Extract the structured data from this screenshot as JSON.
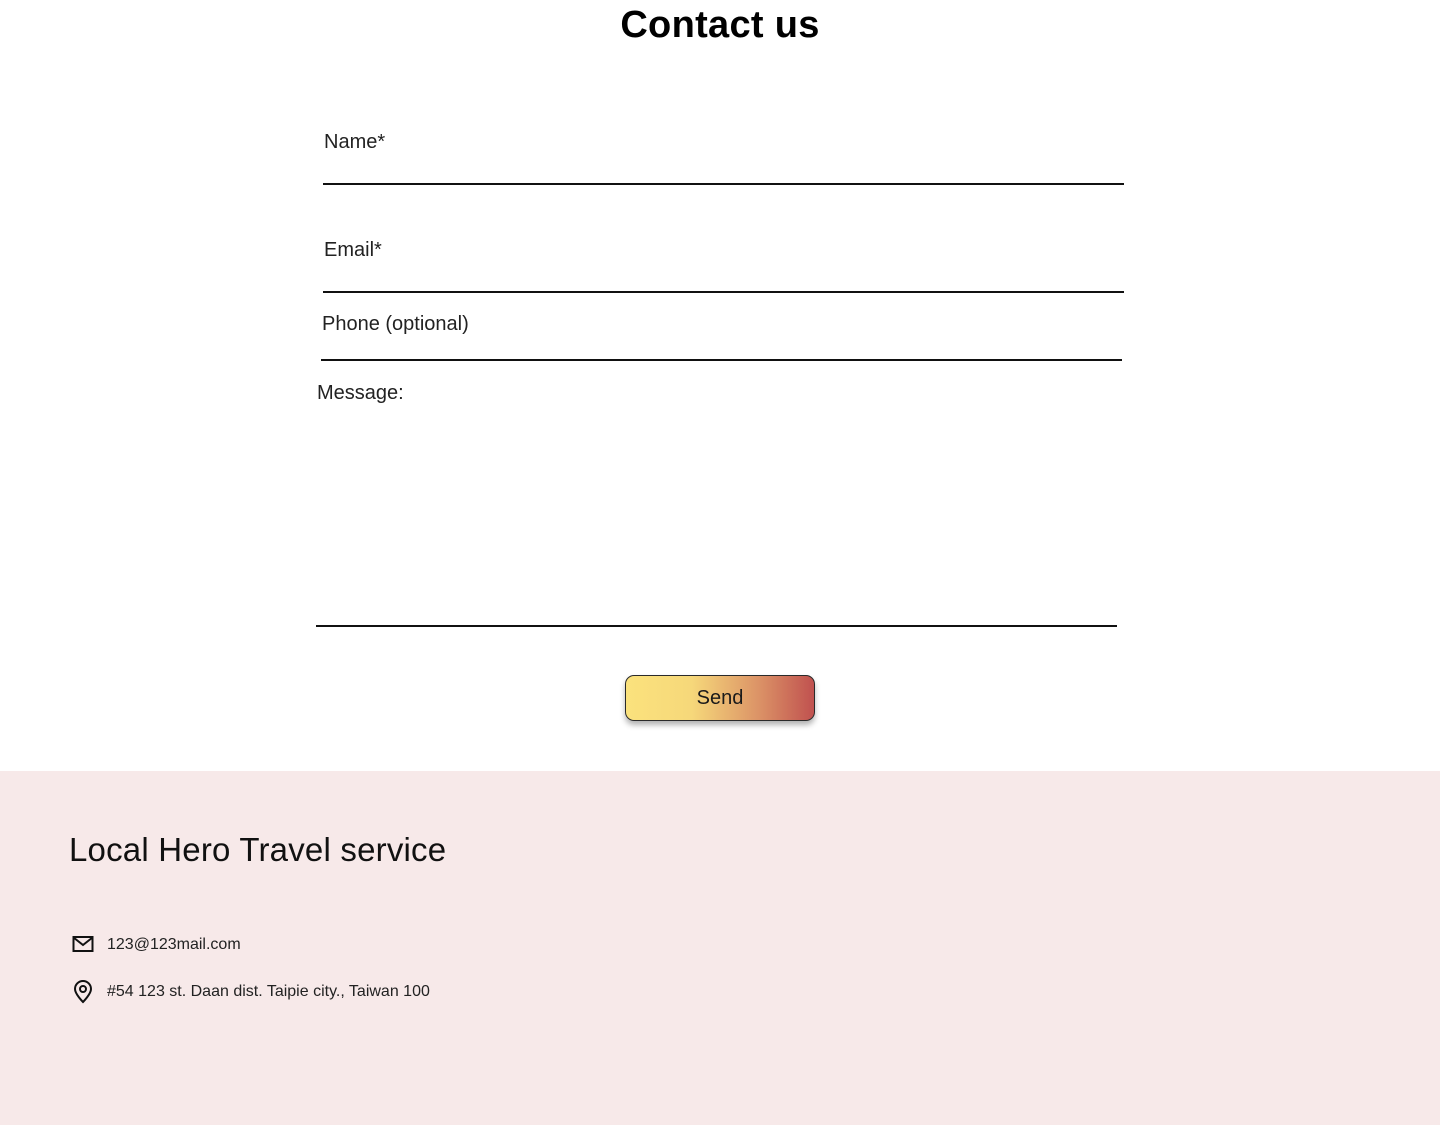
{
  "contact": {
    "title": "Contact us",
    "name_label": "Name*",
    "email_label": "Email*",
    "phone_label": "Phone (optional)",
    "message_label": "Message:",
    "name_value": "",
    "email_value": "",
    "phone_value": "",
    "message_value": "",
    "send_label": "Send"
  },
  "footer": {
    "title": "Local Hero Travel service",
    "email": "123@123mail.com",
    "address": "#54 123 st. Daan dist. Taipie city., Taiwan  100",
    "email_icon": "envelope-icon",
    "address_icon": "map-pin-icon"
  },
  "colors": {
    "footer_background": "#f7e9e9",
    "button_gradient_start": "#fbe27d",
    "button_gradient_end": "#c0514f"
  }
}
